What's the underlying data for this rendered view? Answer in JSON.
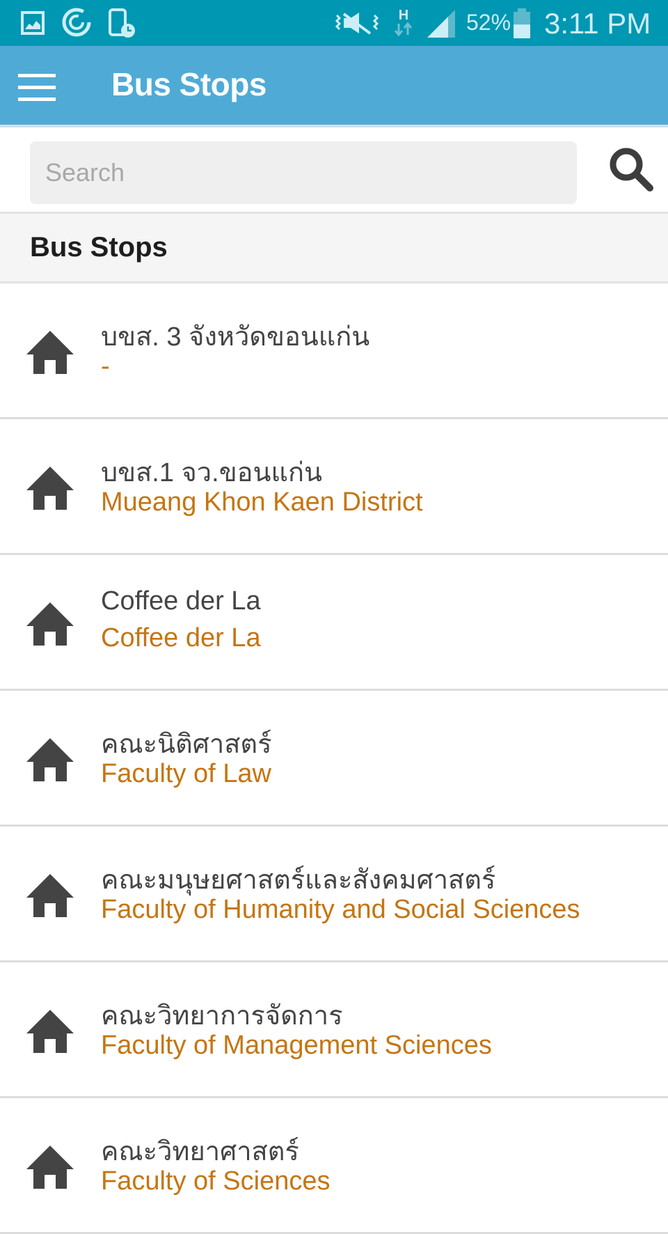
{
  "status_bar": {
    "left_icons": [
      "gallery-icon",
      "sync-icon",
      "device-clock-icon"
    ],
    "right_icons": [
      "vibrate-mute-icon",
      "hspa-data-icon",
      "signal-icon",
      "battery-icon"
    ],
    "network_type": "H",
    "battery_percent": "52%",
    "battery_level": 0.52,
    "time": "3:11 PM"
  },
  "app_bar": {
    "menu_icon": "hamburger-icon",
    "title": "Bus Stops"
  },
  "search": {
    "value": "",
    "placeholder": "Search",
    "button_icon": "search-icon"
  },
  "section": {
    "title": "Bus Stops"
  },
  "colors": {
    "status_bar": "#0097b2",
    "app_bar": "#4fabd6",
    "subtitle": "#c57512",
    "title_text": "#444444",
    "icon": "#444444"
  },
  "bus_stops": [
    {
      "icon": "home-icon",
      "name": "บขส. 3 จังหวัดขอนแก่น",
      "subtitle": "-"
    },
    {
      "icon": "home-icon",
      "name": "บขส.1 จว.ขอนแก่น",
      "subtitle": "Mueang Khon Kaen District"
    },
    {
      "icon": "home-icon",
      "name": "Coffee der La",
      "subtitle": "Coffee der La"
    },
    {
      "icon": "home-icon",
      "name": "คณะนิติศาสตร์",
      "subtitle": "Faculty of Law"
    },
    {
      "icon": "home-icon",
      "name": "คณะมนุษยศาสตร์และสังคมศาสตร์",
      "subtitle": "Faculty of Humanity and Social Sciences"
    },
    {
      "icon": "home-icon",
      "name": "คณะวิทยาการจัดการ",
      "subtitle": "Faculty of Management Sciences"
    },
    {
      "icon": "home-icon",
      "name": "คณะวิทยาศาสตร์",
      "subtitle": "Faculty of Sciences"
    }
  ]
}
